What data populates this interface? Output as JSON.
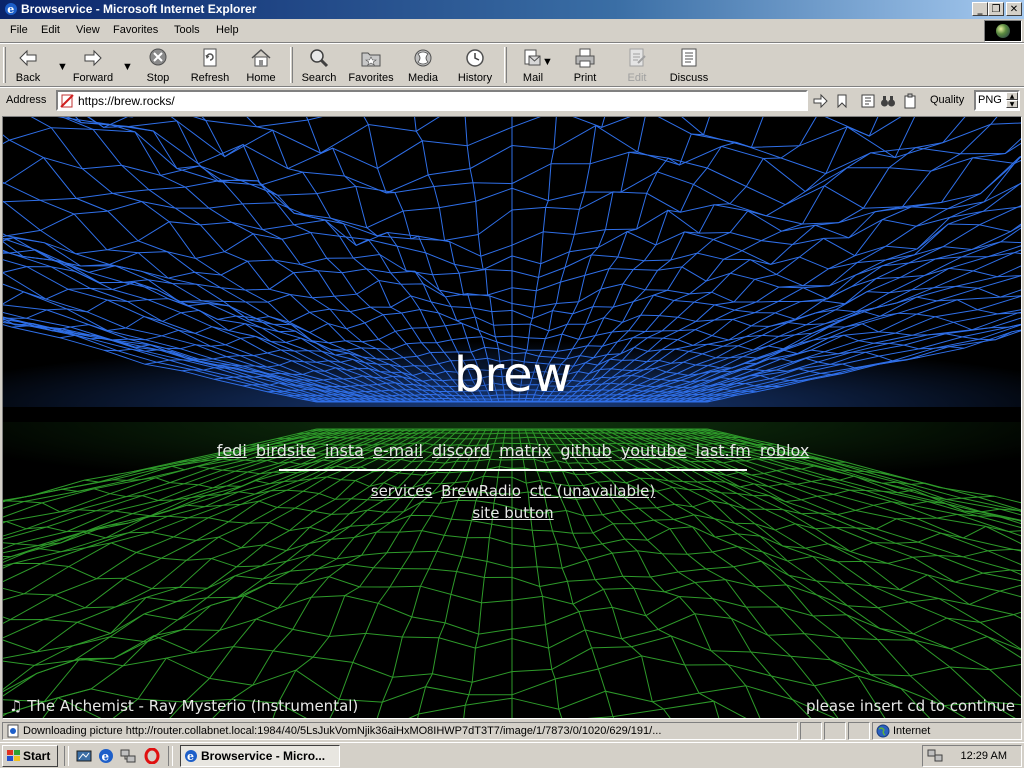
{
  "window": {
    "title": "Browservice - Microsoft Internet Explorer",
    "controls": {
      "minimize": "_",
      "restore": "❐",
      "close": "✕"
    }
  },
  "menu": [
    "File",
    "Edit",
    "View",
    "Favorites",
    "Tools",
    "Help"
  ],
  "toolbar": {
    "back": "Back",
    "forward": "Forward",
    "stop": "Stop",
    "refresh": "Refresh",
    "home": "Home",
    "search": "Search",
    "favorites": "Favorites",
    "media": "Media",
    "history": "History",
    "mail": "Mail",
    "print": "Print",
    "edit": "Edit",
    "discuss": "Discuss"
  },
  "address": {
    "label": "Address",
    "url": "https://brew.rocks/",
    "quality_label": "Quality",
    "quality_value": "PNG"
  },
  "page": {
    "title": "brew",
    "links": [
      "fedi",
      "birdsite",
      "insta",
      "e-mail",
      "discord",
      "matrix",
      "github",
      "youtube",
      "last.fm",
      "roblox"
    ],
    "links2": [
      "services",
      "BrewRadio",
      "ctc (unavailable)"
    ],
    "links3": [
      "site button"
    ],
    "now_playing_icon": "♫",
    "now_playing": "The Alchemist - Ray Mysterio (Instrumental)",
    "footer_right": "please insert cd to continue",
    "colors": {
      "top_mesh": "#2f6fe8",
      "bottom_mesh": "#2e9a2a",
      "background": "#000000"
    }
  },
  "status": {
    "text": "Downloading picture http://router.collabnet.local:1984/40/5LsJukVomNjik36aiHxMO8IHWP7dT3T7/image/1/7873/0/1020/629/191/...",
    "zone": "Internet"
  },
  "taskbar": {
    "start": "Start",
    "task": "Browservice - Micro...",
    "clock": "12:29 AM"
  }
}
